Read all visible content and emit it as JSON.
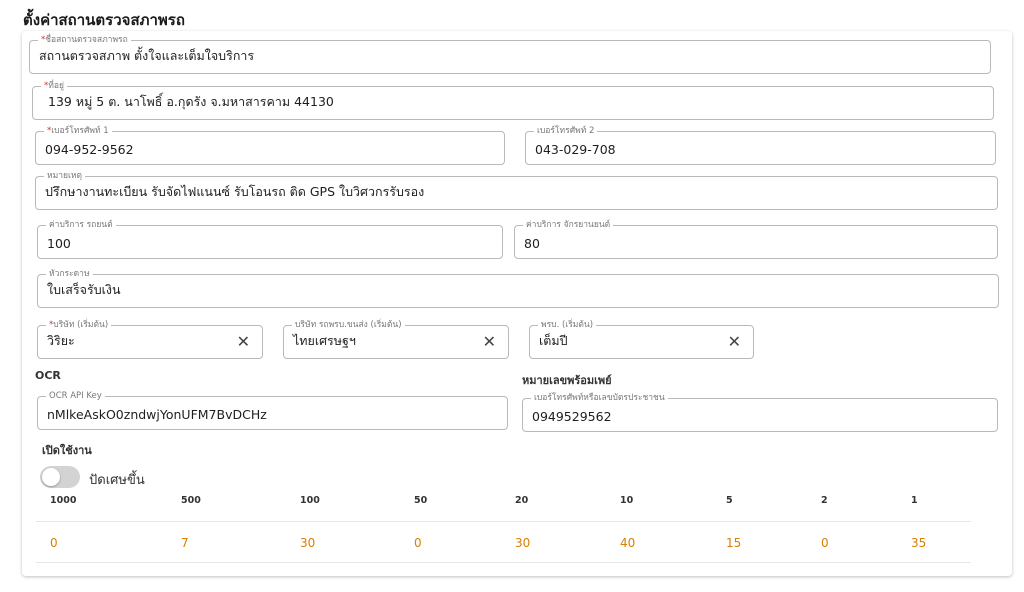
{
  "page_title": "ตั้งค่าสถานตรวจสภาพรถ",
  "fields": {
    "station_name": {
      "label": "ชื่อสถานตรวจสภาพรถ",
      "required": true,
      "value": "สถานตรวจสภาพ ตั้งใจและเต็มใจบริการ"
    },
    "address": {
      "label": "ที่อยู่",
      "required": true,
      "value": "139 หมู่  5 ต. นาโพธิ์ อ.กุดรัง จ.มหาสารคาม 44130"
    },
    "phone1": {
      "label": "เบอร์โทรศัพท์ 1",
      "required": true,
      "value": "094-952-9562"
    },
    "phone2": {
      "label": "เบอร์โทรศัพท์ 2",
      "required": false,
      "value": "043-029-708"
    },
    "note": {
      "label": "หมายเหตุ",
      "required": false,
      "value": "ปรึกษางานทะเบียน  รับจัดไฟแนนซ์  รับโอนรถ ติด GPS ใบวิศวกรรับรอง"
    },
    "car_fee": {
      "label": "ค่าบริการ รถยนต์",
      "required": false,
      "value": "100"
    },
    "moto_fee": {
      "label": "ค่าบริการ จักรยานยนต์",
      "required": false,
      "value": "80"
    },
    "header_paper": {
      "label": "หัวกระดาษ",
      "required": false,
      "value": "ใบเสร็จรับเงิน"
    },
    "company": {
      "label": "บริษัท (เริ่มต้น)",
      "required": true,
      "value": "วิริยะ"
    },
    "company_transport": {
      "label": "บริษัท รถพรบ.ขนส่ง (เริ่มต้น)",
      "required": false,
      "value": "ไทยเศรษฐฯ"
    },
    "prb": {
      "label": "พรบ. (เริ่มต้น)",
      "required": false,
      "value": "เต็มปี"
    },
    "ocr_key": {
      "label": "OCR API Key",
      "required": false,
      "value": "nMlkeAskO0zndwjYonUFM7BvDCHz"
    },
    "promptpay": {
      "label": "เบอร์โทรศัพท์หรือเลขบัตรประชาชน",
      "required": false,
      "value": "0949529562"
    }
  },
  "sections": {
    "ocr": "OCR",
    "promptpay": "หมายเลขพร้อมเพย์",
    "enable": "เปิดใช้งาน"
  },
  "toggle": {
    "label": "ปัดเศษขึ้น",
    "on": false
  },
  "icons": {
    "clear": "close-icon"
  },
  "denominations": [
    {
      "label": "1000",
      "count": "0"
    },
    {
      "label": "500",
      "count": "7"
    },
    {
      "label": "100",
      "count": "30"
    },
    {
      "label": "50",
      "count": "0"
    },
    {
      "label": "20",
      "count": "30"
    },
    {
      "label": "10",
      "count": "40"
    },
    {
      "label": "5",
      "count": "15"
    },
    {
      "label": "2",
      "count": "0"
    },
    {
      "label": "1",
      "count": "35"
    }
  ],
  "colors": {
    "accent": "#d98000",
    "required": "#d32f2f"
  }
}
